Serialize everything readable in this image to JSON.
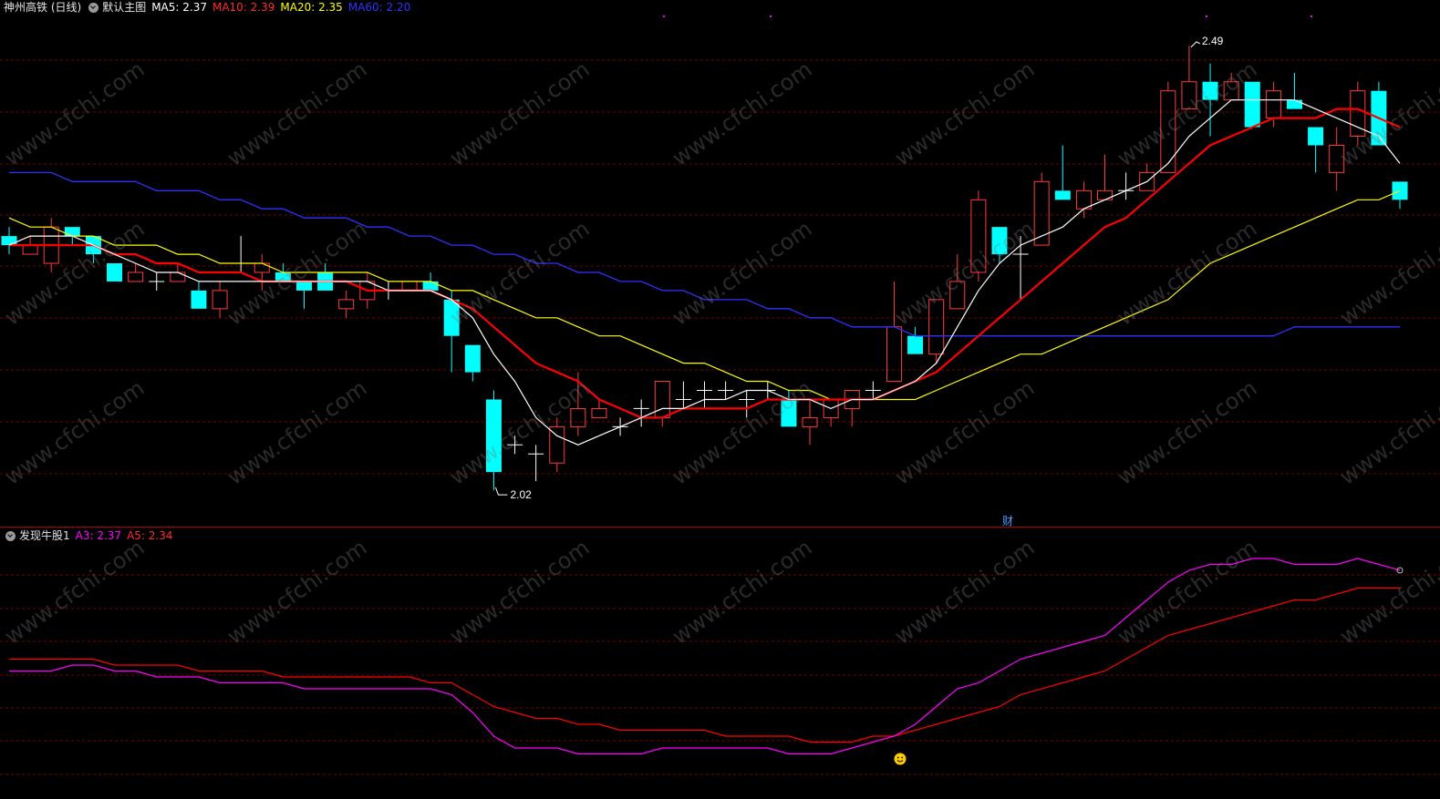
{
  "main_header": {
    "stock_name": "神州高铁 (日线)",
    "template": "默认主图",
    "ma5_label": "MA5: 2.37",
    "ma10_label": "MA10: 2.39",
    "ma20_label": "MA20: 2.35",
    "ma60_label": "MA60: 2.20"
  },
  "sub_header": {
    "indicator_name": "发现牛股1",
    "a3_label": "A3: 2.37",
    "a5_label": "A5: 2.34"
  },
  "annotations": {
    "high_label": "2.49",
    "low_label": "2.02",
    "finance_marker": "财",
    "signal_icon": "smiley-icon"
  },
  "watermark": "www.cfchi.com",
  "colors": {
    "background": "#000000",
    "grid": "#7a0000",
    "up_candle": "#ff3b3b",
    "down_candle": "#00ffff",
    "doji": "#ffffff",
    "ma5": "#ffffff",
    "ma10": "#ff0000",
    "ma20": "#ffff00",
    "ma60": "#3030ff",
    "a3": "#ff00ff",
    "a5": "#ff0000"
  },
  "chart_data": [
    {
      "type": "candlestick",
      "title": "神州高铁 (日线)",
      "ylim": [
        1.99,
        2.54
      ],
      "candles": [
        [
          2.3,
          2.29,
          2.31,
          2.28
        ],
        [
          2.28,
          2.29,
          2.3,
          2.28
        ],
        [
          2.27,
          2.31,
          2.32,
          2.26
        ],
        [
          2.31,
          2.3,
          2.31,
          2.29
        ],
        [
          2.3,
          2.28,
          2.3,
          2.27
        ],
        [
          2.27,
          2.25,
          2.27,
          2.25
        ],
        [
          2.25,
          2.26,
          2.27,
          2.25
        ],
        [
          2.25,
          2.25,
          2.26,
          2.24
        ],
        [
          2.25,
          2.26,
          2.27,
          2.25
        ],
        [
          2.24,
          2.22,
          2.25,
          2.22
        ],
        [
          2.22,
          2.24,
          2.25,
          2.21
        ],
        [
          2.27,
          2.27,
          2.3,
          2.26
        ],
        [
          2.26,
          2.27,
          2.28,
          2.24
        ],
        [
          2.26,
          2.25,
          2.27,
          2.25
        ],
        [
          2.25,
          2.24,
          2.25,
          2.22
        ],
        [
          2.26,
          2.24,
          2.27,
          2.24
        ],
        [
          2.22,
          2.23,
          2.24,
          2.21
        ],
        [
          2.23,
          2.25,
          2.26,
          2.22
        ],
        [
          2.24,
          2.24,
          2.25,
          2.23
        ],
        [
          2.24,
          2.25,
          2.25,
          2.24
        ],
        [
          2.25,
          2.24,
          2.26,
          2.24
        ],
        [
          2.23,
          2.19,
          2.24,
          2.15
        ],
        [
          2.18,
          2.15,
          2.18,
          2.14
        ],
        [
          2.12,
          2.04,
          2.13,
          2.02
        ],
        [
          2.07,
          2.07,
          2.08,
          2.06
        ],
        [
          2.06,
          2.06,
          2.07,
          2.03
        ],
        [
          2.05,
          2.09,
          2.1,
          2.04
        ],
        [
          2.09,
          2.11,
          2.15,
          2.08
        ],
        [
          2.1,
          2.11,
          2.12,
          2.1
        ],
        [
          2.09,
          2.09,
          2.1,
          2.08
        ],
        [
          2.11,
          2.11,
          2.12,
          2.09
        ],
        [
          2.1,
          2.14,
          2.14,
          2.09
        ],
        [
          2.12,
          2.12,
          2.14,
          2.11
        ],
        [
          2.13,
          2.13,
          2.14,
          2.11
        ],
        [
          2.13,
          2.13,
          2.14,
          2.12
        ],
        [
          2.12,
          2.12,
          2.13,
          2.1
        ],
        [
          2.13,
          2.13,
          2.14,
          2.12
        ],
        [
          2.12,
          2.09,
          2.13,
          2.09
        ],
        [
          2.09,
          2.1,
          2.12,
          2.07
        ],
        [
          2.1,
          2.12,
          2.12,
          2.09
        ],
        [
          2.11,
          2.13,
          2.13,
          2.09
        ],
        [
          2.13,
          2.13,
          2.14,
          2.12
        ],
        [
          2.14,
          2.2,
          2.25,
          2.14
        ],
        [
          2.19,
          2.17,
          2.2,
          2.17
        ],
        [
          2.17,
          2.23,
          2.23,
          2.16
        ],
        [
          2.22,
          2.25,
          2.28,
          2.22
        ],
        [
          2.26,
          2.34,
          2.35,
          2.25
        ],
        [
          2.31,
          2.28,
          2.31,
          2.27
        ],
        [
          2.28,
          2.28,
          2.3,
          2.23
        ],
        [
          2.29,
          2.36,
          2.37,
          2.29
        ],
        [
          2.35,
          2.34,
          2.4,
          2.34
        ],
        [
          2.33,
          2.35,
          2.36,
          2.32
        ],
        [
          2.34,
          2.35,
          2.39,
          2.34
        ],
        [
          2.35,
          2.35,
          2.37,
          2.34
        ],
        [
          2.35,
          2.37,
          2.38,
          2.35
        ],
        [
          2.37,
          2.46,
          2.47,
          2.37
        ],
        [
          2.44,
          2.47,
          2.51,
          2.44
        ],
        [
          2.47,
          2.45,
          2.49,
          2.41
        ],
        [
          2.45,
          2.47,
          2.48,
          2.45
        ],
        [
          2.47,
          2.42,
          2.47,
          2.42
        ],
        [
          2.43,
          2.46,
          2.47,
          2.42
        ],
        [
          2.45,
          2.44,
          2.48,
          2.44
        ],
        [
          2.42,
          2.4,
          2.42,
          2.37
        ],
        [
          2.37,
          2.4,
          2.42,
          2.35
        ],
        [
          2.41,
          2.46,
          2.47,
          2.4
        ],
        [
          2.46,
          2.4,
          2.47,
          2.4
        ],
        [
          2.36,
          2.34,
          2.36,
          2.33
        ]
      ],
      "ma5": [
        2.29,
        2.3,
        2.3,
        2.3,
        2.29,
        2.28,
        2.27,
        2.26,
        2.26,
        2.25,
        2.25,
        2.25,
        2.25,
        2.25,
        2.25,
        2.25,
        2.25,
        2.25,
        2.24,
        2.24,
        2.24,
        2.23,
        2.21,
        2.17,
        2.14,
        2.1,
        2.08,
        2.07,
        2.08,
        2.09,
        2.1,
        2.11,
        2.11,
        2.12,
        2.12,
        2.13,
        2.13,
        2.12,
        2.12,
        2.11,
        2.12,
        2.12,
        2.13,
        2.14,
        2.16,
        2.2,
        2.24,
        2.27,
        2.29,
        2.3,
        2.31,
        2.33,
        2.34,
        2.35,
        2.36,
        2.38,
        2.41,
        2.43,
        2.45,
        2.45,
        2.45,
        2.45,
        2.44,
        2.43,
        2.42,
        2.41,
        2.38
      ],
      "ma10": [
        2.29,
        2.29,
        2.29,
        2.29,
        2.29,
        2.28,
        2.28,
        2.27,
        2.27,
        2.26,
        2.26,
        2.26,
        2.25,
        2.25,
        2.25,
        2.25,
        2.25,
        2.24,
        2.24,
        2.24,
        2.24,
        2.23,
        2.22,
        2.2,
        2.18,
        2.16,
        2.15,
        2.14,
        2.12,
        2.11,
        2.1,
        2.1,
        2.11,
        2.11,
        2.11,
        2.11,
        2.12,
        2.12,
        2.12,
        2.12,
        2.12,
        2.12,
        2.13,
        2.14,
        2.15,
        2.17,
        2.19,
        2.21,
        2.23,
        2.25,
        2.27,
        2.29,
        2.31,
        2.32,
        2.34,
        2.36,
        2.38,
        2.4,
        2.41,
        2.42,
        2.43,
        2.43,
        2.43,
        2.44,
        2.44,
        2.43,
        2.42
      ],
      "ma20": [
        2.32,
        2.31,
        2.31,
        2.3,
        2.3,
        2.29,
        2.29,
        2.29,
        2.28,
        2.28,
        2.27,
        2.27,
        2.27,
        2.26,
        2.26,
        2.26,
        2.26,
        2.26,
        2.25,
        2.25,
        2.25,
        2.24,
        2.24,
        2.23,
        2.22,
        2.21,
        2.21,
        2.2,
        2.19,
        2.19,
        2.18,
        2.17,
        2.16,
        2.16,
        2.15,
        2.14,
        2.14,
        2.13,
        2.13,
        2.12,
        2.12,
        2.12,
        2.12,
        2.12,
        2.13,
        2.14,
        2.15,
        2.16,
        2.17,
        2.17,
        2.18,
        2.19,
        2.2,
        2.21,
        2.22,
        2.23,
        2.25,
        2.27,
        2.28,
        2.29,
        2.3,
        2.31,
        2.32,
        2.33,
        2.34,
        2.34,
        2.35
      ],
      "ma60": [
        2.37,
        2.37,
        2.37,
        2.36,
        2.36,
        2.36,
        2.36,
        2.35,
        2.35,
        2.35,
        2.34,
        2.34,
        2.33,
        2.33,
        2.32,
        2.32,
        2.32,
        2.31,
        2.31,
        2.3,
        2.3,
        2.29,
        2.29,
        2.28,
        2.28,
        2.27,
        2.27,
        2.26,
        2.26,
        2.25,
        2.25,
        2.24,
        2.24,
        2.23,
        2.23,
        2.23,
        2.22,
        2.22,
        2.21,
        2.21,
        2.2,
        2.2,
        2.2,
        2.19,
        2.19,
        2.19,
        2.19,
        2.19,
        2.19,
        2.19,
        2.19,
        2.19,
        2.19,
        2.19,
        2.19,
        2.19,
        2.19,
        2.19,
        2.19,
        2.19,
        2.19,
        2.2,
        2.2,
        2.2,
        2.2,
        2.2,
        2.2
      ]
    },
    {
      "type": "line",
      "title": "发现牛股1",
      "ylim": [
        2.09,
        2.49
      ],
      "series": [
        {
          "name": "A3",
          "values": [
            2.28,
            2.28,
            2.28,
            2.29,
            2.29,
            2.28,
            2.28,
            2.27,
            2.27,
            2.27,
            2.26,
            2.26,
            2.26,
            2.26,
            2.25,
            2.25,
            2.25,
            2.25,
            2.25,
            2.25,
            2.25,
            2.24,
            2.21,
            2.17,
            2.15,
            2.15,
            2.15,
            2.14,
            2.14,
            2.14,
            2.14,
            2.15,
            2.15,
            2.15,
            2.15,
            2.15,
            2.15,
            2.14,
            2.14,
            2.14,
            2.15,
            2.16,
            2.17,
            2.19,
            2.22,
            2.25,
            2.26,
            2.28,
            2.3,
            2.31,
            2.32,
            2.33,
            2.34,
            2.37,
            2.4,
            2.43,
            2.45,
            2.46,
            2.46,
            2.47,
            2.47,
            2.46,
            2.46,
            2.46,
            2.47,
            2.46,
            2.45
          ]
        },
        {
          "name": "A5",
          "values": [
            2.3,
            2.3,
            2.3,
            2.3,
            2.3,
            2.29,
            2.29,
            2.29,
            2.29,
            2.28,
            2.28,
            2.28,
            2.28,
            2.27,
            2.27,
            2.27,
            2.27,
            2.27,
            2.27,
            2.27,
            2.26,
            2.26,
            2.24,
            2.22,
            2.21,
            2.2,
            2.2,
            2.19,
            2.19,
            2.18,
            2.18,
            2.18,
            2.18,
            2.18,
            2.17,
            2.17,
            2.17,
            2.17,
            2.16,
            2.16,
            2.16,
            2.17,
            2.17,
            2.18,
            2.19,
            2.2,
            2.21,
            2.22,
            2.24,
            2.25,
            2.26,
            2.27,
            2.28,
            2.3,
            2.32,
            2.34,
            2.35,
            2.36,
            2.37,
            2.38,
            2.39,
            2.4,
            2.4,
            2.41,
            2.42,
            2.42,
            2.42
          ]
        }
      ]
    }
  ]
}
